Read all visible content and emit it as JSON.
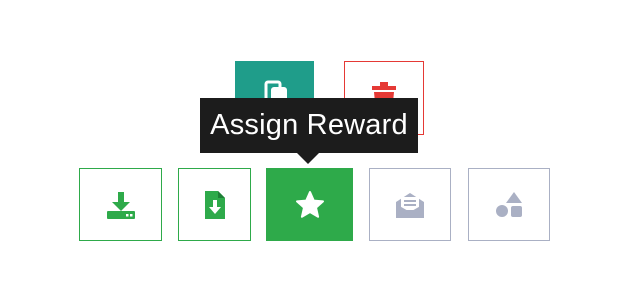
{
  "tooltip": {
    "text": "Assign Reward"
  },
  "colors": {
    "green": "#2eaa4a",
    "teal": "#1f9d8a",
    "red": "#e53935",
    "gray": "#aab0c4",
    "tooltip_bg": "#1c1c1c"
  },
  "actions": {
    "top": [
      {
        "name": "copy",
        "icon": "copy-icon",
        "style": "filled-teal"
      },
      {
        "name": "delete",
        "icon": "trash-icon",
        "style": "outline-red"
      }
    ],
    "bottom": [
      {
        "name": "download",
        "icon": "download-tray-icon",
        "style": "outline-green"
      },
      {
        "name": "file-download",
        "icon": "file-download-icon",
        "style": "outline-green"
      },
      {
        "name": "assign-reward",
        "icon": "star-icon",
        "style": "filled-green",
        "active": true
      },
      {
        "name": "mail",
        "icon": "open-envelope-icon",
        "style": "outline-gray"
      },
      {
        "name": "shapes",
        "icon": "shapes-icon",
        "style": "outline-gray"
      }
    ]
  }
}
